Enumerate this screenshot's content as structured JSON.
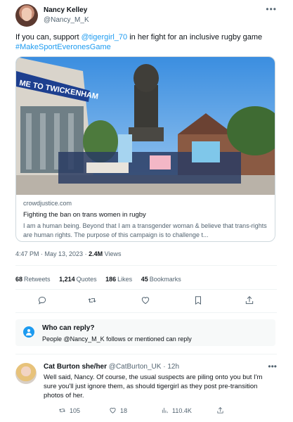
{
  "tweet": {
    "author_name": "Nancy Kelley",
    "author_handle": "@Nancy_M_K",
    "text_before": "If you can, support ",
    "mention": "@tigergirl_70",
    "text_after": " in her fight for an inclusive rugby game",
    "hashtag": "#MakeSportEveronesGame",
    "more_icon": "more-dots-icon"
  },
  "card": {
    "image_banner": "ME TO TWICKENHAM",
    "domain": "crowdjustice.com",
    "title": "Fighting the ban on trans women in rugby",
    "description": "I am a human being. Beyond that I am a transgender woman & believe that trans-rights are human rights. The purpose of this campaign is to challenge t..."
  },
  "meta": {
    "time": "4:47 PM",
    "date": "May 13, 2023",
    "views": "2.4M",
    "views_label": "Views"
  },
  "stats": [
    {
      "value": "68",
      "label": "Retweets"
    },
    {
      "value": "1,214",
      "label": "Quotes"
    },
    {
      "value": "186",
      "label": "Likes"
    },
    {
      "value": "45",
      "label": "Bookmarks"
    }
  ],
  "actions": [
    "reply-icon",
    "retweet-icon",
    "like-icon",
    "bookmark-icon",
    "share-icon"
  ],
  "reply_restriction": {
    "title": "Who can reply?",
    "subtitle": "People @Nancy_M_K follows or mentioned can reply"
  },
  "reply": {
    "author_name": "Cat Burton she/her",
    "author_handle": "@CatBurton_UK",
    "time": "12h",
    "text": "Well said, Nancy. Of course, the usual suspects are piling onto you but I'm sure you'll just ignore them, as should tigergirl as they post pre-transition photos of her.",
    "retweets": "105",
    "likes": "18",
    "views": "110.4K"
  },
  "colors": {
    "accent": "#1d9bf0",
    "text": "#0f1419",
    "secondary": "#536471",
    "border": "#cfd9de"
  }
}
